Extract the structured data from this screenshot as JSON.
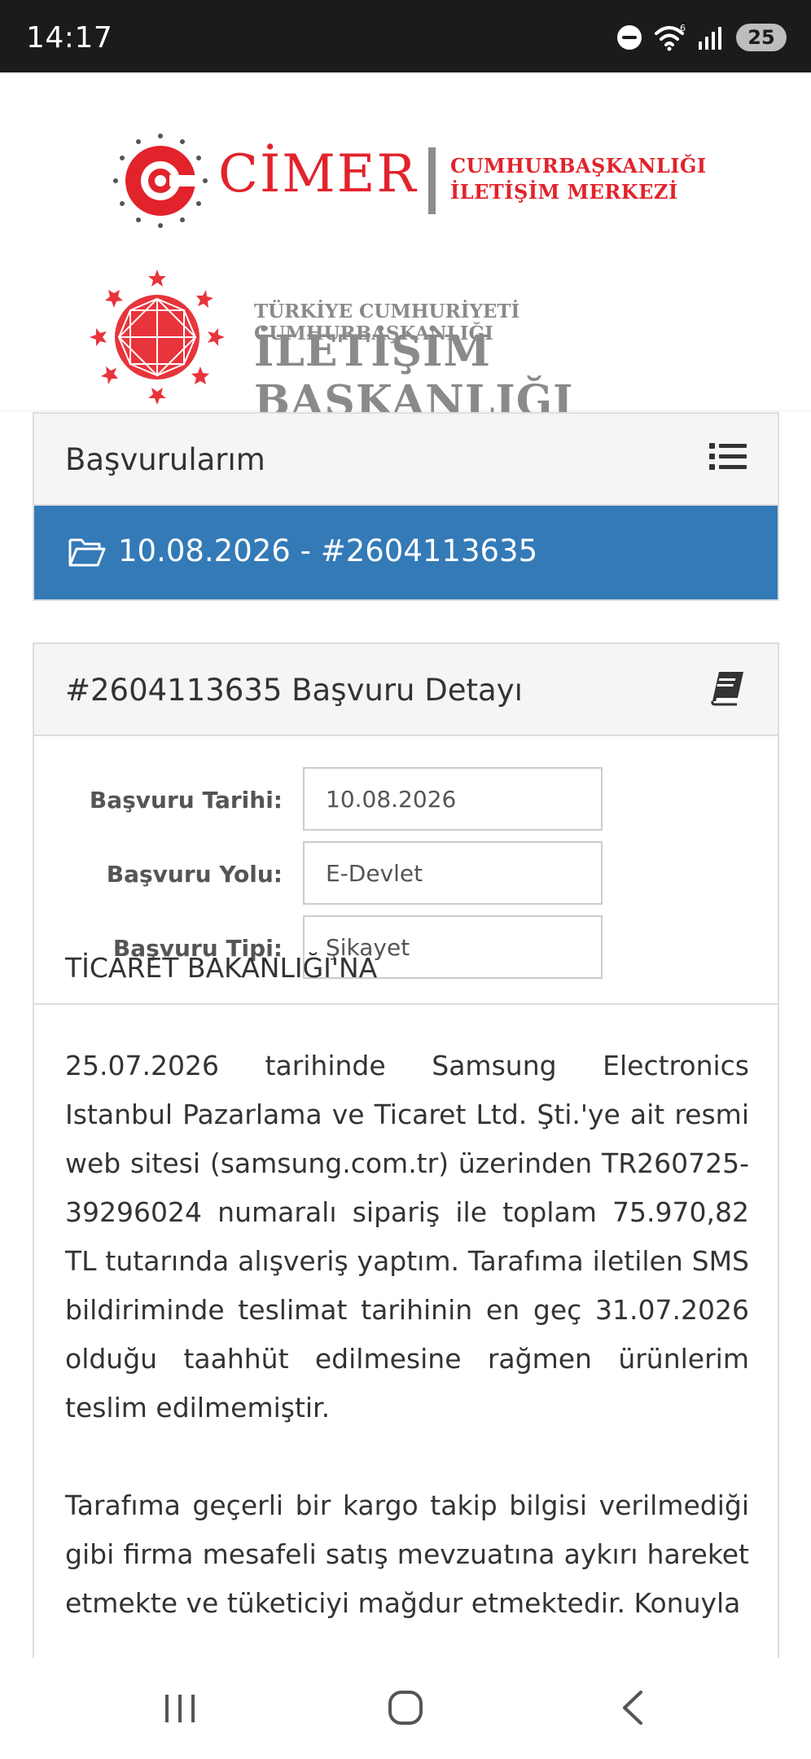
{
  "status_bar": {
    "time": "14:17",
    "battery": "25",
    "icons": [
      "do-not-disturb-icon",
      "wifi-icon",
      "signal-icon",
      "battery-icon"
    ]
  },
  "header": {
    "cimer": {
      "name": "CİMER",
      "subtitle_line1": "CUMHURBAŞKANLIĞI",
      "subtitle_line2": "İLETİŞİM MERKEZİ"
    },
    "iletisim": {
      "subtitle": "TÜRKİYE CUMHURİYETİ CUMHURBAŞKANLIĞI",
      "name": "İLETİŞİM BAŞKANLIĞI"
    }
  },
  "applications_panel": {
    "title": "Başvurularım",
    "menu_icon": "list-icon",
    "active_item": {
      "icon": "folder-open-icon",
      "label": "10.08.2026 - #2604113635"
    }
  },
  "detail_panel": {
    "title": "#2604113635 Başvuru Detayı",
    "icon": "book-icon",
    "fields": [
      {
        "label": "Başvuru Tarihi:",
        "value": "10.08.2026"
      },
      {
        "label": "Başvuru Yolu:",
        "value": "E-Devlet"
      },
      {
        "label": "Başvuru Tipi:",
        "value": "Şikayet"
      }
    ],
    "content": {
      "addressee": "TİCARET BAKANLIĞI'NA",
      "paragraph1": "25.07.2026 tarihinde Samsung Electronics Istanbul Pazarlama ve Ticaret Ltd. Şti.'ye ait resmi web sitesi (samsung.com.tr) üzerinden TR260725-39296024 numaralı sipariş ile toplam 75.970,82 TL tutarında alışveriş yaptım. Tarafıma iletilen SMS bildiriminde teslimat tarihinin en geç 31.07.2026 olduğu taahhüt edilmesine rağmen ürünlerim teslim edilmemiştir.",
      "paragraph2": "Tarafıma geçerli bir kargo takip bilgisi verilmediği gibi firma mesafeli satış mevzuatına aykırı hareket etmekte ve tüketiciyi mağdur etmektedir. Konuyla"
    }
  },
  "nav_bar": {
    "buttons": [
      "recent-apps-icon",
      "home-icon",
      "back-icon"
    ]
  },
  "colors": {
    "status_bar_bg": "#1b1b1b",
    "brand_red": "#e2232b",
    "primary_blue": "#337ab7",
    "panel_heading_bg": "#f5f5f5",
    "logo_gray": "#8a8a8a"
  }
}
